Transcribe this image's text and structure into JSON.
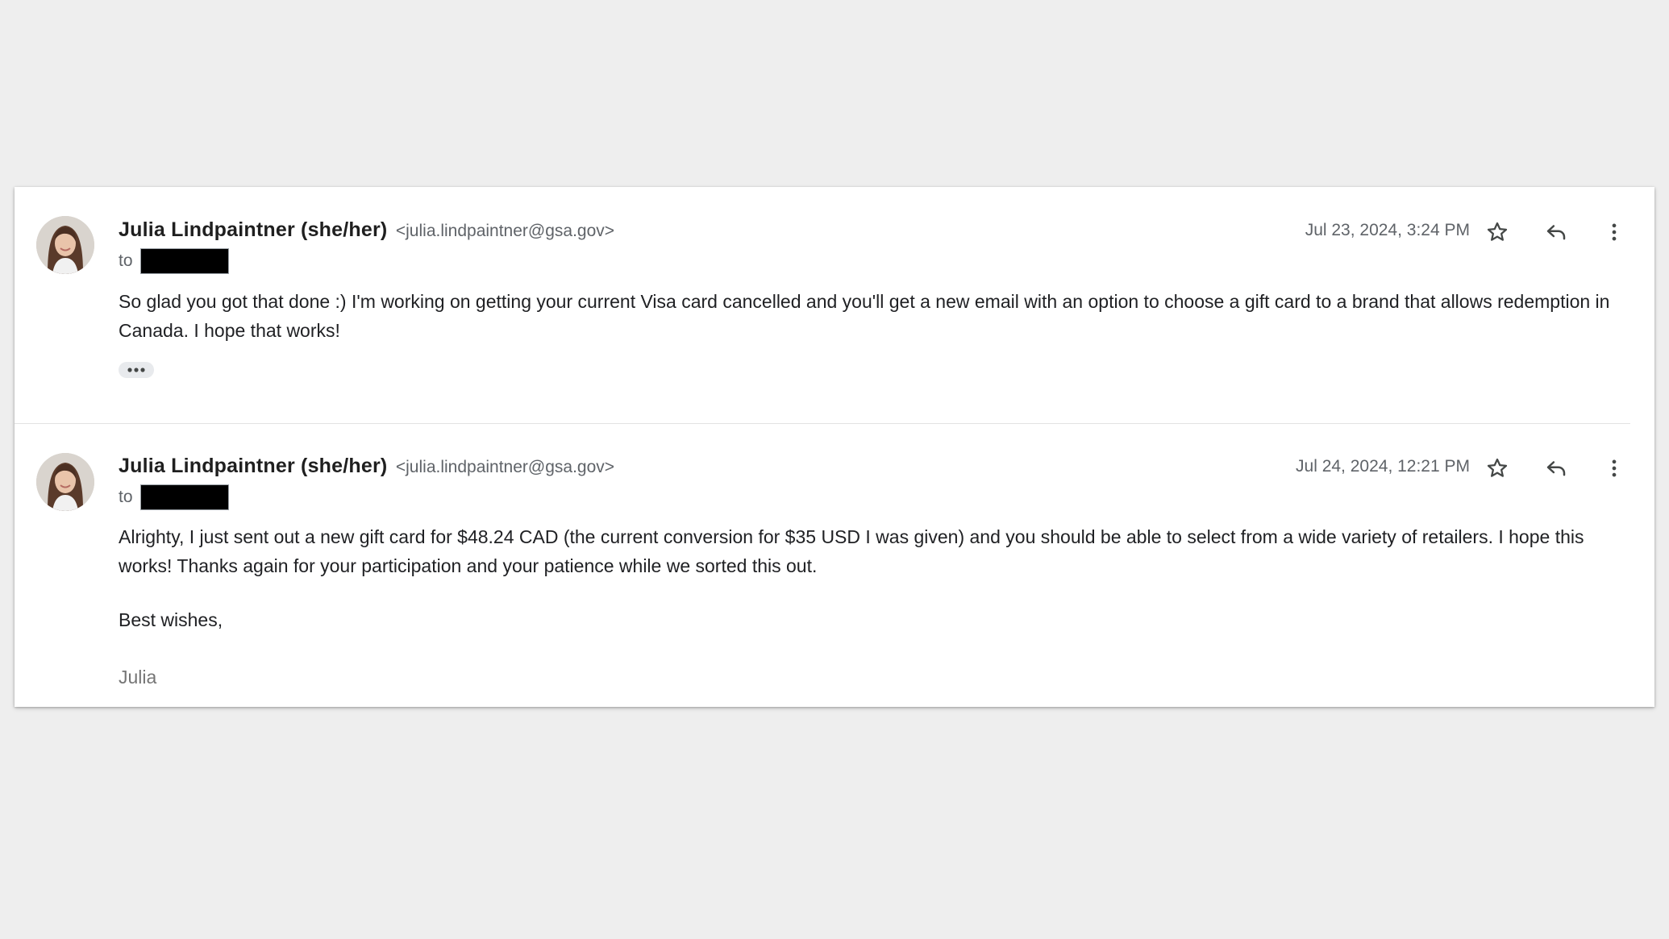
{
  "messages": [
    {
      "sender_name": "Julia Lindpaintner (she/her)",
      "sender_email": "<julia.lindpaintner@gsa.gov>",
      "to_label": "to",
      "date": "Jul 23, 2024, 3:24 PM",
      "body": "So glad you got that done :) I'm working on getting your current Visa card cancelled and you'll get a new email with an option to choose a gift card to a brand that allows redemption in Canada. I hope that works!"
    },
    {
      "sender_name": "Julia Lindpaintner (she/her)",
      "sender_email": "<julia.lindpaintner@gsa.gov>",
      "to_label": "to",
      "date": "Jul 24, 2024, 12:21 PM",
      "body": "Alrighty, I just sent out a new gift card for $48.24 CAD (the current conversion for $35 USD I was given) and you should be able to select from a wide variety of retailers. I hope this works! Thanks again for your participation and your patience while we sorted this out.",
      "closing": "Best wishes,",
      "signature": "Julia"
    }
  ],
  "icons": {
    "star": "star-icon",
    "reply": "reply-icon",
    "more": "more-vert-icon",
    "ellipsis": "ellipsis-icon"
  },
  "colors": {
    "background": "#eeeeee",
    "card": "#ffffff",
    "secondary_text": "#5f6368",
    "signature_text": "#757575",
    "redaction": "#000000"
  }
}
